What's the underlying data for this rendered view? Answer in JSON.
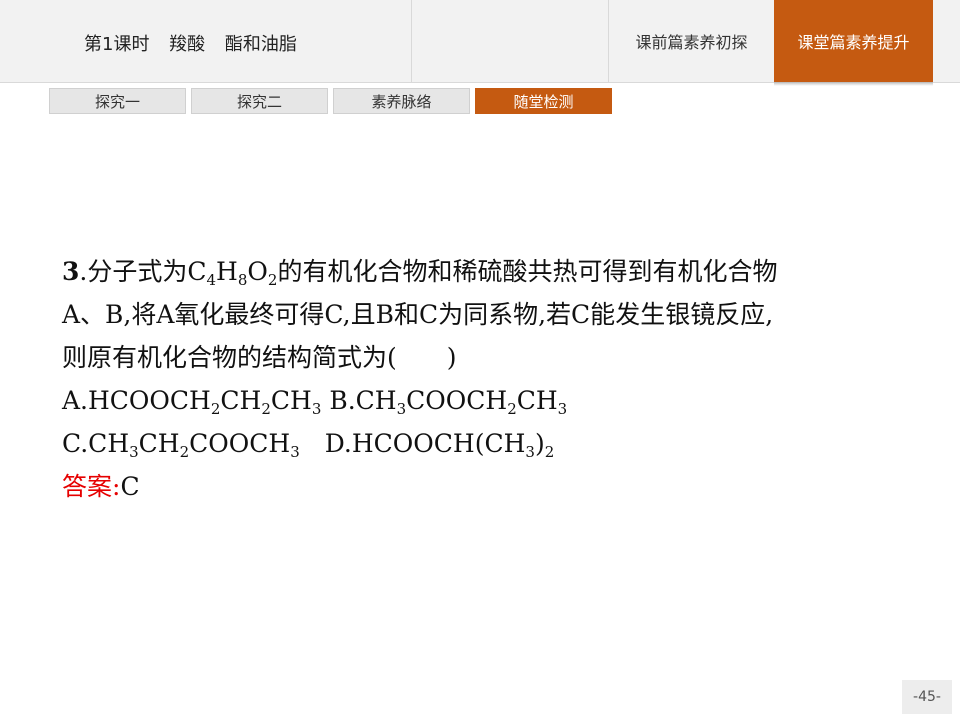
{
  "header": {
    "title": "第1课时  羧酸  酯和油脂",
    "nav": [
      {
        "label": "课前篇素养初探",
        "active": false
      },
      {
        "label": "课堂篇素养提升",
        "active": true
      }
    ]
  },
  "tabs": [
    {
      "label": "探究一",
      "active": false
    },
    {
      "label": "探究二",
      "active": false
    },
    {
      "label": "素养脉络",
      "active": false
    },
    {
      "label": "随堂检测",
      "active": true
    }
  ],
  "question": {
    "number": "3",
    "stem_line1": {
      "pre": ".分子式为C",
      "s1": "4",
      "m1": "H",
      "s2": "8",
      "m2": "O",
      "s3": "2",
      "post": "的有机化合物和稀硫酸共热可得到有机化合物"
    },
    "stem_line2": "A、B,将A氧化最终可得C,且B和C为同系物,若C能发生银镜反应,",
    "stem_line3": "则原有机化合物的结构简式为(　　)",
    "option_a": {
      "t1": "A.HCOOCH",
      "s1": "2",
      "t2": "CH",
      "s2": "2",
      "t3": "CH",
      "s3": "3"
    },
    "option_b": {
      "t1": " B.CH",
      "s1": "3",
      "t2": "COOCH",
      "s2": "2",
      "t3": "CH",
      "s3": "3"
    },
    "option_c": {
      "t1": "C.CH",
      "s1": "3",
      "t2": "CH",
      "s2": "2",
      "t3": "COOCH",
      "s3": "3"
    },
    "option_d": {
      "t1": "　D.HCOOCH(CH",
      "s1": "3",
      "t2": ")",
      "s2": "2"
    },
    "answer_label": "答案:",
    "answer_value": "C"
  },
  "page_number": "-45-",
  "colors": {
    "accent": "#c55a11",
    "answer": "#e60000"
  }
}
